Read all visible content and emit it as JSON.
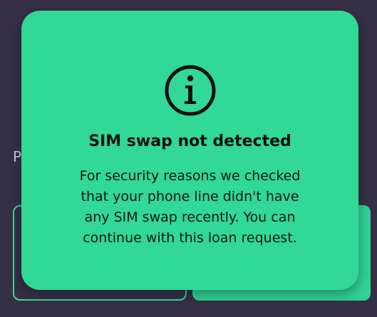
{
  "background": {
    "partial_char": "P"
  },
  "modal": {
    "icon": "info-icon",
    "title": "SIM swap not detected",
    "message_lines": [
      "For security reasons we checked",
      "that your phone line didn't have",
      "any SIM swap recently. You can",
      "continue with this loan request."
    ]
  },
  "colors": {
    "background": "#363047",
    "accent_green": "#31d896",
    "text": "#111111"
  }
}
